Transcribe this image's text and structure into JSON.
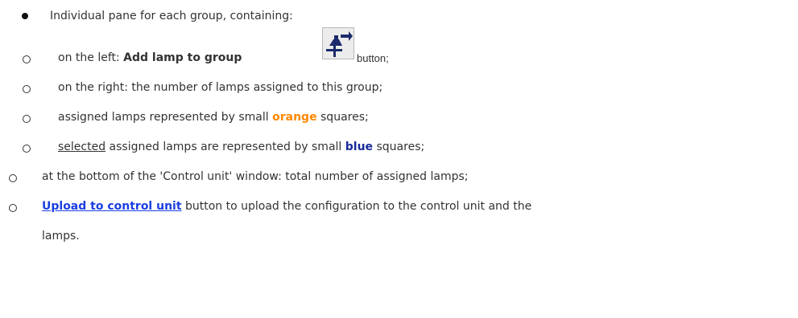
{
  "items": {
    "group_pane": "Individual pane for each group, containing:",
    "left_prefix": "on the left: ",
    "left_bold": "Add lamp to group",
    "left_suffix": "button;",
    "right": "on the right: the number of lamps assigned to this group;",
    "orange_prefix": "assigned lamps represented by small ",
    "orange_word": "orange",
    "orange_suffix": " squares;",
    "blue_underlined": "selected",
    "blue_mid": " assigned lamps are represented by small ",
    "blue_word": "blue",
    "blue_suffix": " squares;",
    "bottom": "at the bottom of the 'Control unit' window: total number of assigned lamps;",
    "upload_link": "Upload to control unit",
    "upload_rest": " button to upload the configuration to the control unit and the",
    "upload_cont": "lamps."
  },
  "icons": {
    "add_lamp": "add-lamp-to-group-icon"
  },
  "colors": {
    "orange": "#ff8800",
    "blue": "#1a2a9c",
    "link": "#1a3fe0"
  }
}
